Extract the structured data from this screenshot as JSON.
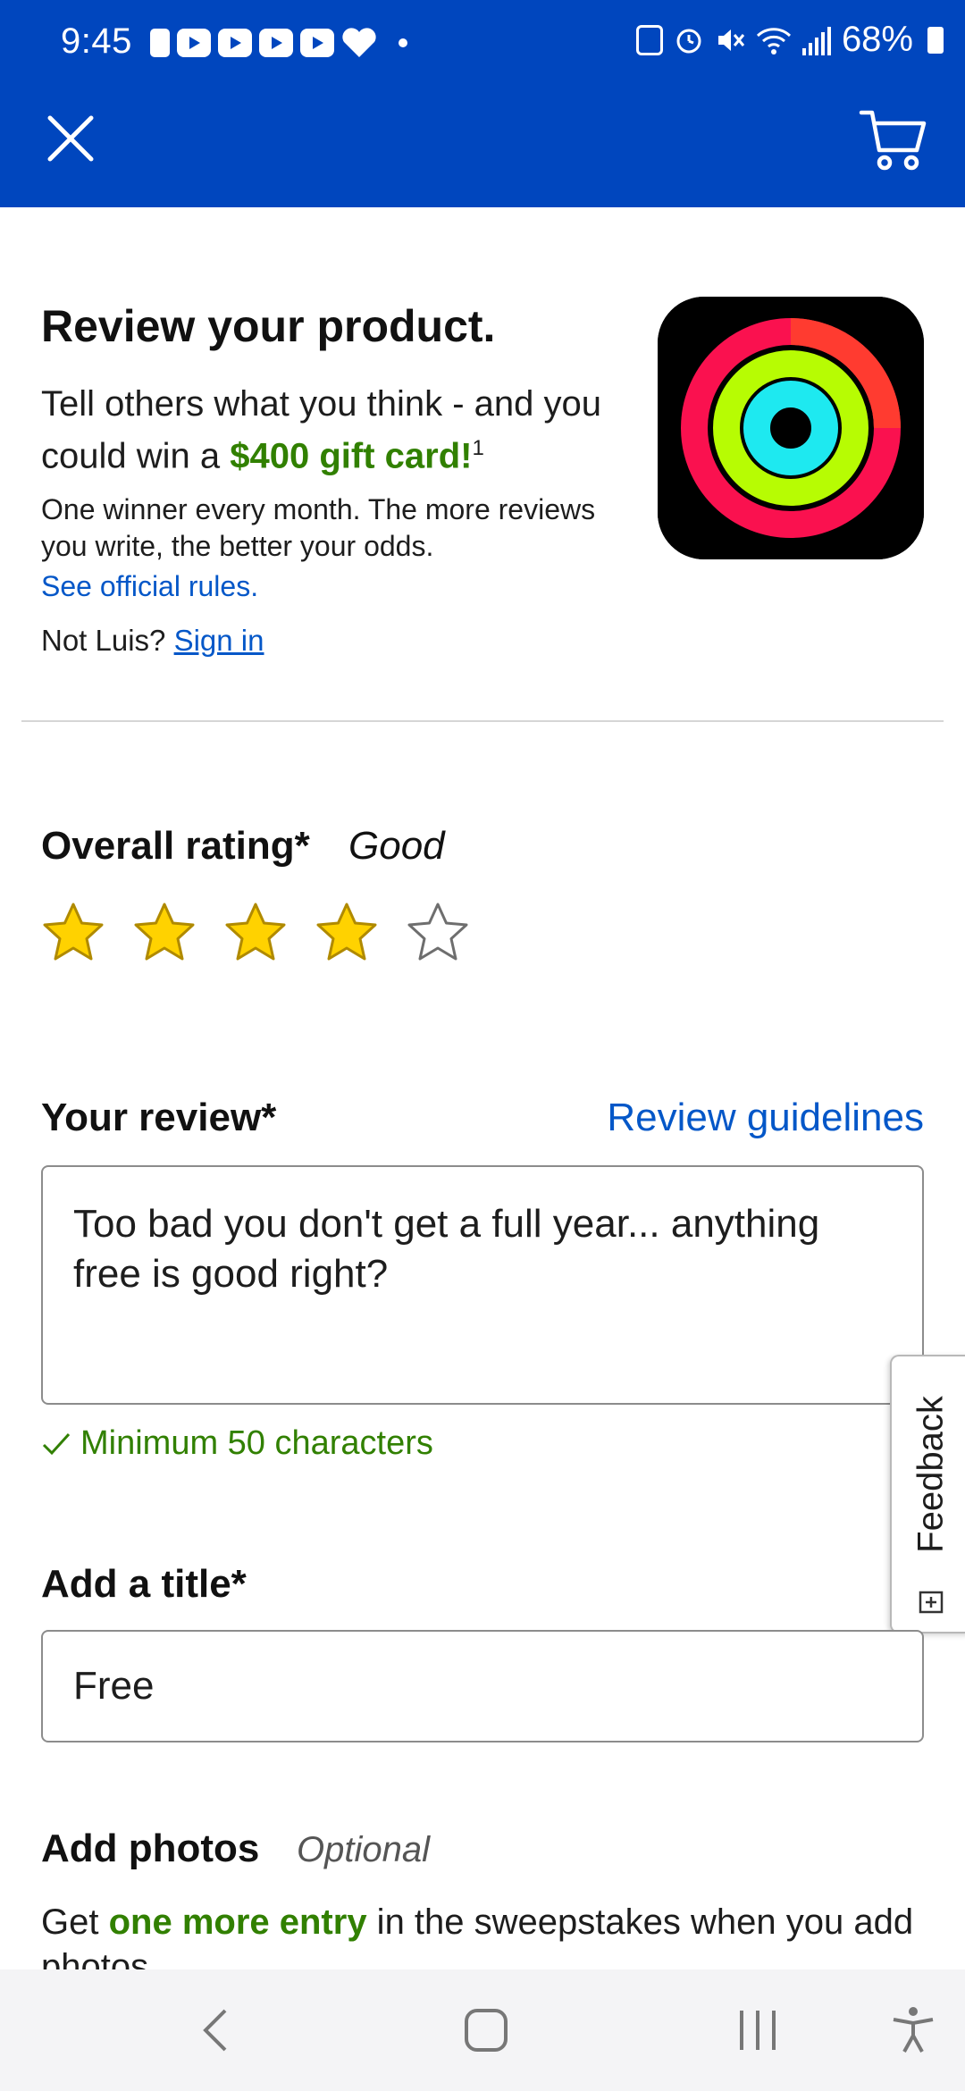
{
  "status_bar": {
    "time": "9:45",
    "battery": "68%",
    "notification_icons": [
      "shield-notification-icon",
      "youtube-icon",
      "youtube-icon",
      "youtube-icon",
      "youtube-icon",
      "heart-app-icon",
      "dot-icon"
    ],
    "system_icons": [
      "battery-saver-icon",
      "alarm-icon",
      "mute-icon",
      "wifi-icon",
      "signal-icon",
      "battery-icon"
    ]
  },
  "app_bar": {
    "background": "#0046be",
    "left_icon": "close-icon",
    "right_icon": "cart-icon"
  },
  "header": {
    "title": "Review your product.",
    "promo_before": "Tell others what you think - and you could win a ",
    "promo_highlight": "$400 gift card!",
    "promo_footnote": "1",
    "details": "One winner every month. The more reviews you write, the better your odds.",
    "rules_link": "See official rules.",
    "not_user": "Not Luis?",
    "sign_in": "Sign in",
    "product_image": "activity-rings-app-icon"
  },
  "rating": {
    "label": "Overall rating*",
    "value_text": "Good",
    "value": 4,
    "max": 5
  },
  "review": {
    "label": "Your review*",
    "guidelines_link": "Review guidelines",
    "text": "Too bad you don't get a full year... anything free is good right?",
    "validation": "Minimum 50 characters"
  },
  "title_field": {
    "label": "Add a title*",
    "value": "Free"
  },
  "photos": {
    "label": "Add photos",
    "optional": "Optional",
    "text_before": "Get ",
    "text_highlight": "one more entry",
    "text_after": " in the sweepstakes when you add photos."
  },
  "feedback_tab": {
    "label": "Feedback"
  },
  "colors": {
    "brand_blue": "#0046be",
    "link_blue": "#0457c8",
    "green": "#318000",
    "star_yellow": "#ffd200"
  },
  "nav_bar": {
    "buttons": [
      "back-icon",
      "home-icon",
      "recents-icon",
      "accessibility-icon"
    ]
  }
}
